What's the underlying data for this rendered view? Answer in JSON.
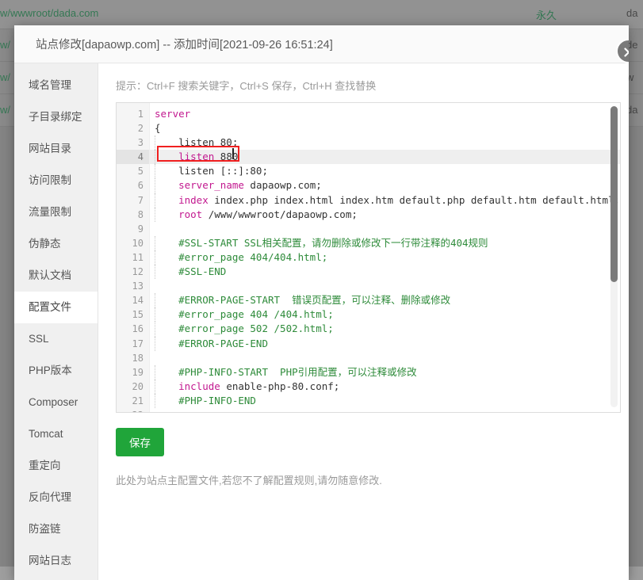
{
  "background": {
    "top_path": "w/wwwroot/dada.com",
    "top_permanent": "永久",
    "top_right_fragment": "da",
    "rows": [
      {
        "left": "w/",
        "right": "de"
      },
      {
        "left": "w/",
        "right": "w"
      },
      {
        "left": "w/",
        "right": "da"
      }
    ]
  },
  "modal": {
    "title": "站点修改[dapaowp.com] -- 添加时间[2021-09-26 16:51:24]",
    "close_icon": "close-icon"
  },
  "sidebar": {
    "items": [
      {
        "label": "域名管理",
        "active": false
      },
      {
        "label": "子目录绑定",
        "active": false
      },
      {
        "label": "网站目录",
        "active": false
      },
      {
        "label": "访问限制",
        "active": false
      },
      {
        "label": "流量限制",
        "active": false
      },
      {
        "label": "伪静态",
        "active": false
      },
      {
        "label": "默认文档",
        "active": false
      },
      {
        "label": "配置文件",
        "active": true
      },
      {
        "label": "SSL",
        "active": false
      },
      {
        "label": "PHP版本",
        "active": false
      },
      {
        "label": "Composer",
        "active": false
      },
      {
        "label": "Tomcat",
        "active": false
      },
      {
        "label": "重定向",
        "active": false
      },
      {
        "label": "反向代理",
        "active": false
      },
      {
        "label": "防盗链",
        "active": false
      },
      {
        "label": "网站日志",
        "active": false
      }
    ]
  },
  "content": {
    "tip": "提示：Ctrl+F 搜索关键字，Ctrl+S 保存，Ctrl+H 查找替换",
    "save_label": "保存",
    "note": "此处为站点主配置文件,若您不了解配置规则,请勿随意修改.",
    "save_color": "#20a53a"
  },
  "editor": {
    "highlight_line": 4,
    "annotation_color": "#f02020",
    "lines": [
      {
        "n": 1,
        "tokens": [
          {
            "t": "server",
            "c": "kw"
          }
        ]
      },
      {
        "n": 2,
        "tokens": [
          {
            "t": "{",
            "c": "txt"
          }
        ]
      },
      {
        "n": 3,
        "tokens": [
          {
            "t": "    listen 80;",
            "c": "txt"
          }
        ]
      },
      {
        "n": 4,
        "tokens": [
          {
            "t": "    ",
            "c": "txt"
          },
          {
            "t": "listen",
            "c": "kw"
          },
          {
            "t": " 880",
            "c": "txt"
          }
        ]
      },
      {
        "n": 5,
        "tokens": [
          {
            "t": "    listen [::]:80;",
            "c": "txt"
          }
        ]
      },
      {
        "n": 6,
        "tokens": [
          {
            "t": "    ",
            "c": "txt"
          },
          {
            "t": "server_name",
            "c": "kw"
          },
          {
            "t": " dapaowp.com;",
            "c": "txt"
          }
        ]
      },
      {
        "n": 7,
        "tokens": [
          {
            "t": "    ",
            "c": "txt"
          },
          {
            "t": "index",
            "c": "kw"
          },
          {
            "t": " index.php index.html index.htm default.php default.htm default.html;",
            "c": "txt"
          }
        ]
      },
      {
        "n": 8,
        "tokens": [
          {
            "t": "    ",
            "c": "txt"
          },
          {
            "t": "root",
            "c": "kw"
          },
          {
            "t": " /www/wwwroot/dapaowp.com;",
            "c": "txt"
          }
        ]
      },
      {
        "n": 9,
        "tokens": [
          {
            "t": "",
            "c": "txt"
          }
        ]
      },
      {
        "n": 10,
        "tokens": [
          {
            "t": "    #SSL-START SSL相关配置，请勿删除或修改下一行带注释的404规则",
            "c": "cmt"
          }
        ]
      },
      {
        "n": 11,
        "tokens": [
          {
            "t": "    #error_page 404/404.html;",
            "c": "cmt"
          }
        ]
      },
      {
        "n": 12,
        "tokens": [
          {
            "t": "    #SSL-END",
            "c": "cmt"
          }
        ]
      },
      {
        "n": 13,
        "tokens": [
          {
            "t": "",
            "c": "txt"
          }
        ]
      },
      {
        "n": 14,
        "tokens": [
          {
            "t": "    #ERROR-PAGE-START  错误页配置，可以注释、删除或修改",
            "c": "cmt"
          }
        ]
      },
      {
        "n": 15,
        "tokens": [
          {
            "t": "    #error_page 404 /404.html;",
            "c": "cmt"
          }
        ]
      },
      {
        "n": 16,
        "tokens": [
          {
            "t": "    #error_page 502 /502.html;",
            "c": "cmt"
          }
        ]
      },
      {
        "n": 17,
        "tokens": [
          {
            "t": "    #ERROR-PAGE-END",
            "c": "cmt"
          }
        ]
      },
      {
        "n": 18,
        "tokens": [
          {
            "t": "",
            "c": "txt"
          }
        ]
      },
      {
        "n": 19,
        "tokens": [
          {
            "t": "    #PHP-INFO-START  PHP引用配置，可以注释或修改",
            "c": "cmt"
          }
        ]
      },
      {
        "n": 20,
        "tokens": [
          {
            "t": "    ",
            "c": "txt"
          },
          {
            "t": "include",
            "c": "kw"
          },
          {
            "t": " enable-php-80.conf;",
            "c": "txt"
          }
        ]
      },
      {
        "n": 21,
        "tokens": [
          {
            "t": "    #PHP-INFO-END",
            "c": "cmt"
          }
        ]
      },
      {
        "n": 22,
        "tokens": [
          {
            "t": "",
            "c": "txt"
          }
        ]
      }
    ]
  }
}
